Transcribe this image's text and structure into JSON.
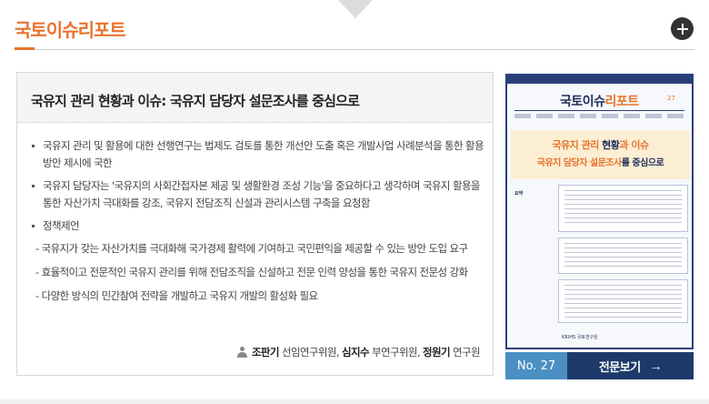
{
  "section": {
    "title": "국토이슈리포트"
  },
  "report": {
    "title": "국유지 관리 현황과 이슈: 국유지 담당자 설문조사를 중심으로",
    "summary": [
      "국유지 관리 및 활용에 대한 선행연구는 법제도 검토를 통한 개선안 도출 혹은 개발사업 사례분석을 통한 활용방안 제시에 국한",
      "국유지 담당자는 '국유지의 사회간접자본 제공 및 생활환경 조성 기능'을 중요하다고 생각하며 국유지 활용을 통한 자산가치 극대화를 강조, 국유지 전담조직 신설과 관리시스템 구축을 요청함",
      "정책제언"
    ],
    "policy_items": [
      "- 국유지가 갖는 자산가치를 극대화해 국가경제 활력에 기여하고 국민편익을 제공할 수 있는 방안 도입 요구",
      "- 효율적이고 전문적인 국유지 관리를 위해 전담조직을 신설하고 전문 인력 양성을 통한 국유지 전문성 강화",
      "- 다양한 방식의 민간참여 전략을 개발하고 국유지 개발의 활성화 필요"
    ],
    "authors": [
      {
        "name": "조판기",
        "role": "선임연구위원"
      },
      {
        "name": "심지수",
        "role": "부연구위원"
      },
      {
        "name": "정원기",
        "role": "연구원"
      }
    ],
    "number": "No. 27",
    "view_label": "전문보기",
    "cover": {
      "brand_a": "국토이슈",
      "brand_b": "리포트",
      "issue": "27",
      "headline_a": "국유지 관리",
      "headline_b": " 현황",
      "headline_c": "과 이슈",
      "subline_a": "국유지 담당자 설문조사",
      "subline_b": "를 중심으로",
      "section_label": "요약",
      "publisher": "KRIHS 국토연구원"
    }
  },
  "colors": {
    "accent": "#e8732e",
    "navy": "#1d3a6b",
    "blue": "#4a90c2"
  }
}
